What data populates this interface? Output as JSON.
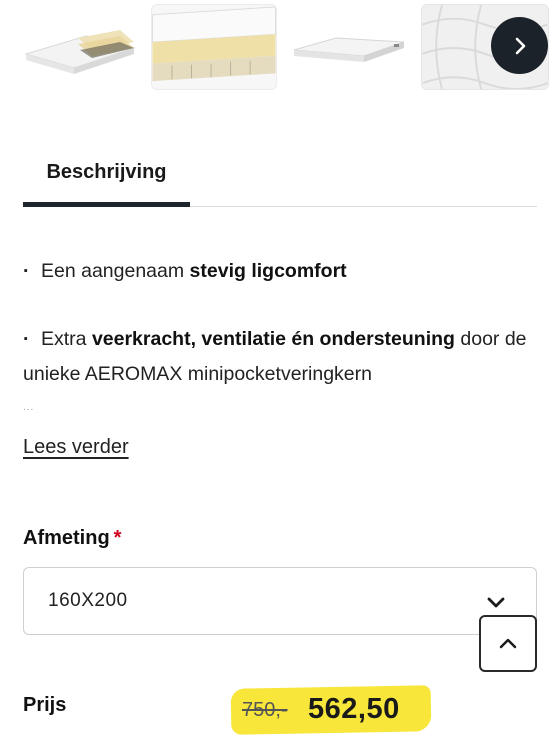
{
  "gallery": {
    "thumbnails": [
      "mattress-layers-image",
      "mattress-foam-closeup-image",
      "mattress-top-view-image",
      "mattress-quilt-detail-image"
    ],
    "next_icon": "chevron-right-icon"
  },
  "tabs": [
    {
      "label": "Beschrijving",
      "active": true
    }
  ],
  "description": {
    "item1": {
      "prefix": "Een aangenaam ",
      "bold": "stevig ligcomfort"
    },
    "item2": {
      "prefix": "Extra ",
      "bold": "veerkracht, ventilatie én ondersteuning",
      "suffix": " door de unieke AEROMAX minipocketveringkern"
    },
    "ellipsis": "...",
    "read_more": "Lees verder"
  },
  "size": {
    "label": "Afmeting",
    "required_mark": "*",
    "selected": "160X200",
    "chevron_icon": "chevron-down-icon"
  },
  "scroll_top_icon": "chevron-up-icon",
  "price": {
    "label": "Prijs",
    "old": "750,-",
    "current": "562,50",
    "highlight_color": "#f8e63a"
  },
  "colors": {
    "accent_dark": "#1f252c",
    "required": "#d0021b"
  }
}
